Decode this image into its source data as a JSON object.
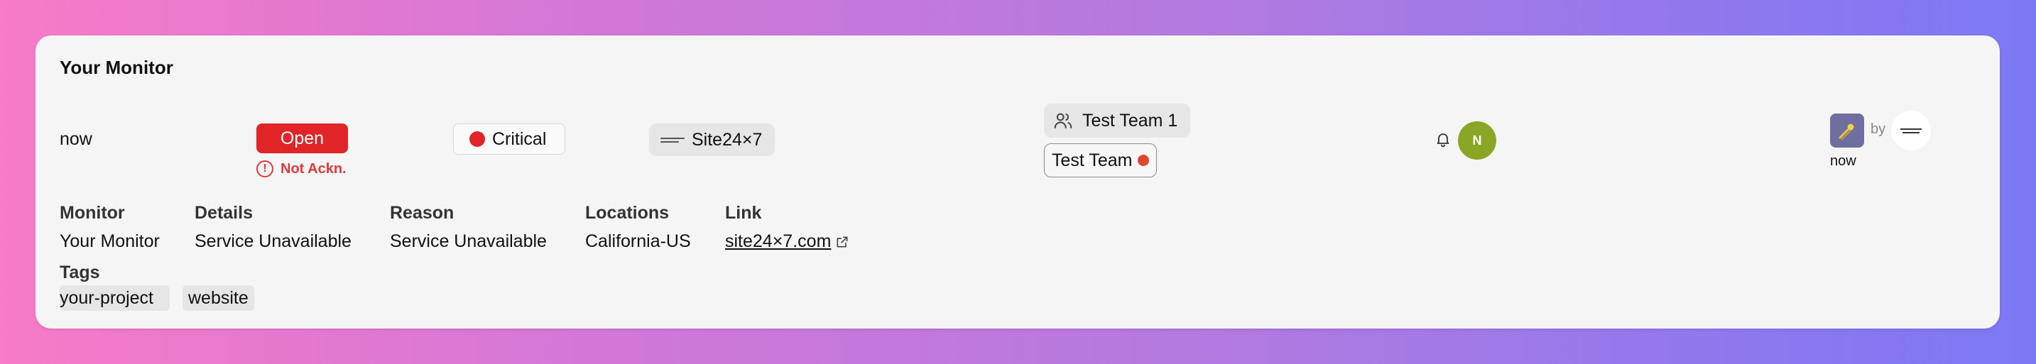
{
  "card": {
    "title": "Your Monitor"
  },
  "row": {
    "time": "now",
    "status_label": "Open",
    "ack_label": "Not Ackn.",
    "severity_label": "Critical",
    "source_label": "Site24×7",
    "teams": [
      {
        "label": "Test Team 1"
      },
      {
        "label": "Test Team"
      }
    ],
    "avatar_initial": "N",
    "by_label": "by",
    "event_time": "now"
  },
  "details": {
    "monitor_label": "Monitor",
    "monitor_value": "Your Monitor",
    "details_label": "Details",
    "details_value": "Service Unavailable",
    "reason_label": "Reason",
    "reason_value": "Service Unavailable",
    "locations_label": "Locations",
    "locations_value": "California-US",
    "link_label": "Link",
    "link_value": "site24×7.com"
  },
  "tags": {
    "label": "Tags",
    "items": [
      "your-project",
      "website"
    ]
  },
  "icons": {
    "ack": "alert-circle-icon",
    "team": "users-icon",
    "bell": "bell-icon",
    "external_link": "external-link-icon",
    "app": "app-icon"
  },
  "colors": {
    "status_open": "#e02427",
    "severity_critical": "#e02427",
    "avatar_bg": "#8aa626",
    "team_dot": "#e0462e",
    "ack_text": "#e0393b"
  }
}
